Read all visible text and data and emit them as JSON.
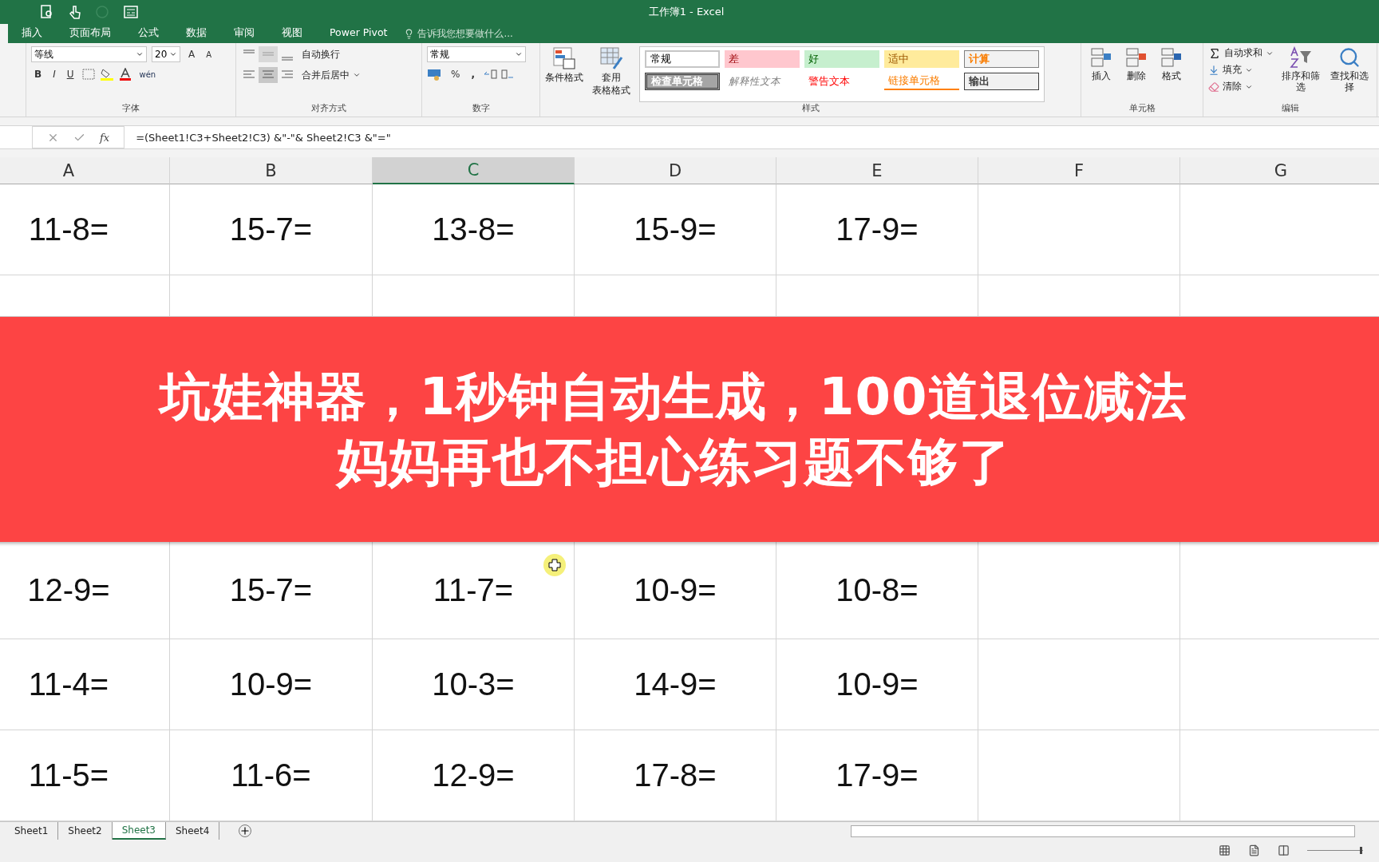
{
  "window": {
    "title": "工作簿1 - Excel"
  },
  "ribbon_tabs": [
    {
      "label": "插入",
      "selected": false
    },
    {
      "label": "页面布局",
      "selected": false
    },
    {
      "label": "公式",
      "selected": false
    },
    {
      "label": "数据",
      "selected": false
    },
    {
      "label": "审阅",
      "selected": false
    },
    {
      "label": "视图",
      "selected": false
    },
    {
      "label": "Power Pivot",
      "selected": false
    }
  ],
  "tell_me": {
    "placeholder": "告诉我您想要做什么..."
  },
  "font_group": {
    "font": "等线",
    "size": "20",
    "bold": "B",
    "italic": "I",
    "underline": "U",
    "grow": "A",
    "shrink": "A",
    "phonetic": "wén",
    "label": "字体"
  },
  "alignment_group": {
    "wrap": "自动换行",
    "merge": "合并后居中",
    "label": "对齐方式"
  },
  "number_group": {
    "format": "常规",
    "percent": "%",
    "comma": ",",
    "label": "数字"
  },
  "styles_group": {
    "conditional": "条件格式",
    "table_format": [
      "套用",
      "表格格式"
    ],
    "label": "样式",
    "styles": [
      {
        "label": "常规",
        "kind": "normal"
      },
      {
        "label": "差",
        "kind": "bad"
      },
      {
        "label": "好",
        "kind": "good"
      },
      {
        "label": "适中",
        "kind": "neutral"
      },
      {
        "label": "计算",
        "kind": "calc"
      },
      {
        "label": "检查单元格",
        "kind": "check"
      },
      {
        "label": "解释性文本",
        "kind": "explain"
      },
      {
        "label": "警告文本",
        "kind": "warn"
      },
      {
        "label": "链接单元格",
        "kind": "link"
      },
      {
        "label": "输出",
        "kind": "output"
      }
    ]
  },
  "cells_group": {
    "insert": "插入",
    "delete": "删除",
    "format": "格式",
    "label": "单元格"
  },
  "editing_group": {
    "autosum": "自动求和",
    "fill": "填充",
    "clear": "清除",
    "sort": "排序和筛选",
    "find": "查找和选择",
    "label": "编辑"
  },
  "formula_bar": {
    "fx": "fx",
    "formula": "=(Sheet1!C3+Sheet2!C3) &\"-\"& Sheet2!C3 &\"=\""
  },
  "columns": [
    {
      "label": "A",
      "selected": false
    },
    {
      "label": "B",
      "selected": false
    },
    {
      "label": "C",
      "selected": true
    },
    {
      "label": "D",
      "selected": false
    },
    {
      "label": "E",
      "selected": false
    },
    {
      "label": "F",
      "selected": false
    },
    {
      "label": "G",
      "selected": false
    }
  ],
  "rows_top": [
    [
      "11-8=",
      "15-7=",
      "13-8=",
      "15-9=",
      "17-9="
    ]
  ],
  "banner": {
    "lines": [
      "坑娃神器，1秒钟自动生成，100道退位减法",
      "妈妈再也不担心练习题不够了"
    ]
  },
  "rows_bottom": [
    [
      "12-9=",
      "15-7=",
      "11-7=",
      "10-9=",
      "10-8="
    ],
    [
      "11-4=",
      "10-9=",
      "10-3=",
      "14-9=",
      "10-9="
    ],
    [
      "11-5=",
      "11-6=",
      "12-9=",
      "17-8=",
      "17-9="
    ]
  ],
  "zoom_slider": {
    "level": 0.97
  },
  "sheet_tabs": [
    {
      "label": "Sheet1",
      "selected": false
    },
    {
      "label": "Sheet2",
      "selected": false
    },
    {
      "label": "Sheet3",
      "selected": true
    },
    {
      "label": "Sheet4",
      "selected": false
    }
  ]
}
